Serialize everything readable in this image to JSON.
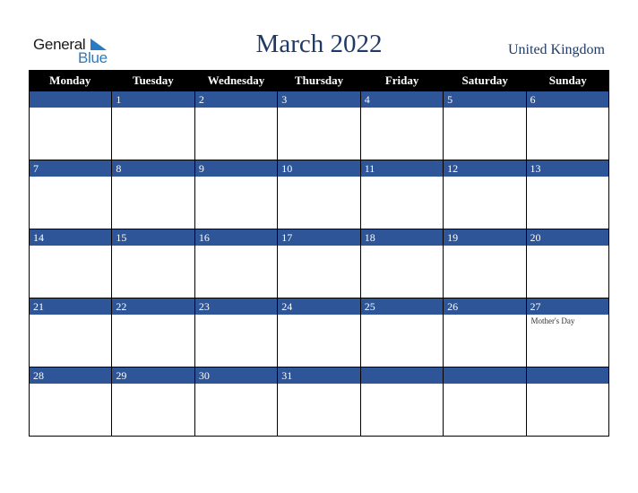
{
  "logo": {
    "general": "General",
    "blue": "Blue"
  },
  "title": "March 2022",
  "country": "United Kingdom",
  "colors": {
    "header_bg": "#000000",
    "date_bar": "#2d5597",
    "title": "#1f3a66",
    "logo_blue": "#2a7bc4"
  },
  "weekdays": [
    "Monday",
    "Tuesday",
    "Wednesday",
    "Thursday",
    "Friday",
    "Saturday",
    "Sunday"
  ],
  "weeks": [
    [
      {
        "d": ""
      },
      {
        "d": "1"
      },
      {
        "d": "2"
      },
      {
        "d": "3"
      },
      {
        "d": "4"
      },
      {
        "d": "5"
      },
      {
        "d": "6"
      }
    ],
    [
      {
        "d": "7"
      },
      {
        "d": "8"
      },
      {
        "d": "9"
      },
      {
        "d": "10"
      },
      {
        "d": "11"
      },
      {
        "d": "12"
      },
      {
        "d": "13"
      }
    ],
    [
      {
        "d": "14"
      },
      {
        "d": "15"
      },
      {
        "d": "16"
      },
      {
        "d": "17"
      },
      {
        "d": "18"
      },
      {
        "d": "19"
      },
      {
        "d": "20"
      }
    ],
    [
      {
        "d": "21"
      },
      {
        "d": "22"
      },
      {
        "d": "23"
      },
      {
        "d": "24"
      },
      {
        "d": "25"
      },
      {
        "d": "26"
      },
      {
        "d": "27",
        "event": "Mother's Day"
      }
    ],
    [
      {
        "d": "28"
      },
      {
        "d": "29"
      },
      {
        "d": "30"
      },
      {
        "d": "31"
      },
      {
        "d": ""
      },
      {
        "d": ""
      },
      {
        "d": ""
      }
    ]
  ]
}
